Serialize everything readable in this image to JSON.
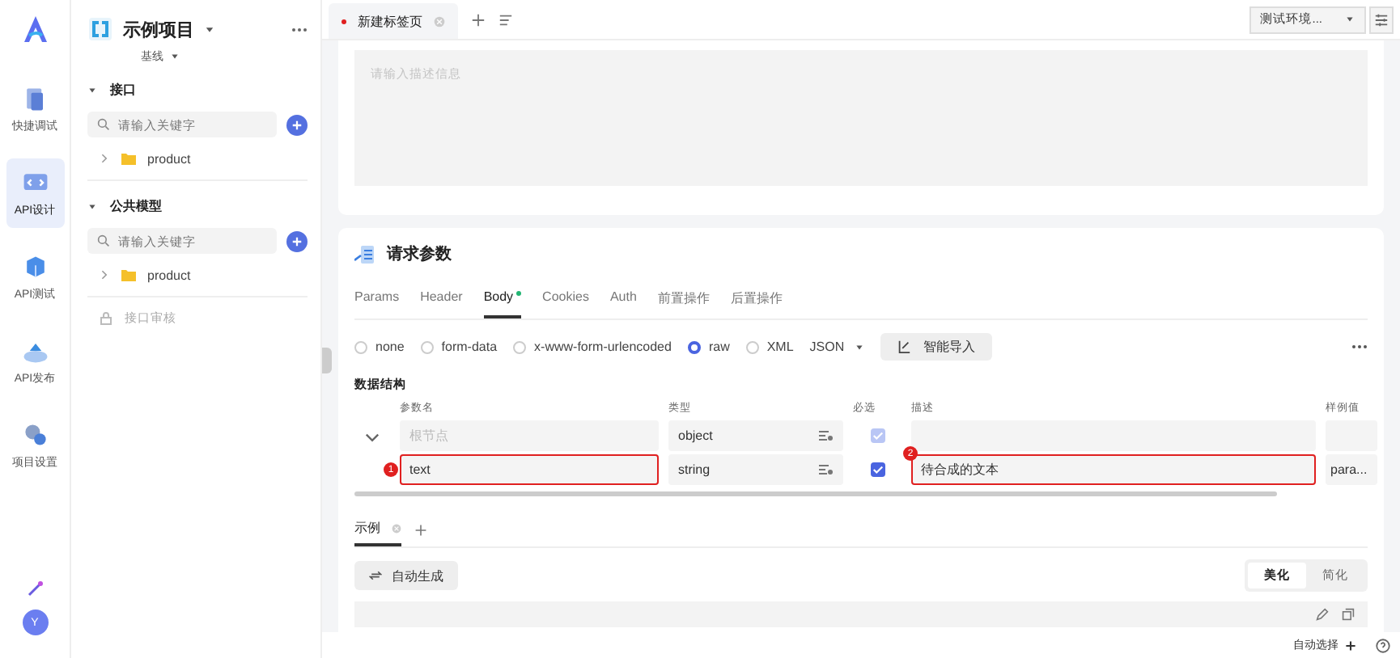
{
  "rail": {
    "items": [
      {
        "label": "快捷调试",
        "selected": false
      },
      {
        "label": "API设计",
        "selected": true
      },
      {
        "label": "API测试",
        "selected": false
      },
      {
        "label": "API发布",
        "selected": false
      },
      {
        "label": "项目设置",
        "selected": false
      }
    ],
    "avatar": "Y"
  },
  "sidebar": {
    "project": "示例项目",
    "branch": "基线",
    "sections": [
      {
        "title": "接口",
        "search_placeholder": "请输入关键字",
        "items": [
          {
            "label": "product"
          }
        ]
      },
      {
        "title": "公共模型",
        "search_placeholder": "请输入关键字",
        "items": [
          {
            "label": "product"
          }
        ]
      }
    ],
    "review": "接口审核"
  },
  "tabs": [
    {
      "label": "新建标签页",
      "selected": true,
      "modified": true
    }
  ],
  "environment": "测试环境...",
  "description": {
    "placeholder": "请输入描述信息"
  },
  "request_params": {
    "title": "请求参数",
    "tabs": [
      {
        "label": "Params",
        "selected": false,
        "has_content": false
      },
      {
        "label": "Header",
        "selected": false,
        "has_content": false
      },
      {
        "label": "Body",
        "selected": true,
        "has_content": true
      },
      {
        "label": "Cookies",
        "selected": false,
        "has_content": false
      },
      {
        "label": "Auth",
        "selected": false,
        "has_content": false
      },
      {
        "label": "前置操作",
        "selected": false,
        "has_content": false
      },
      {
        "label": "后置操作",
        "selected": false,
        "has_content": false
      }
    ],
    "body_types": [
      {
        "label": "none",
        "selected": false
      },
      {
        "label": "form-data",
        "selected": false
      },
      {
        "label": "x-www-form-urlencoded",
        "selected": false
      },
      {
        "label": "raw",
        "selected": true
      },
      {
        "label": "XML",
        "selected": false
      }
    ],
    "format": "JSON",
    "import_button": "智能导入",
    "structure_title": "数据结构",
    "columns": [
      "参数名",
      "类型",
      "必选",
      "描述",
      "样例值"
    ],
    "rows": [
      {
        "expanded": true,
        "name": {
          "placeholder": "根节点"
        },
        "type": "object",
        "required": true,
        "required_disabled": true,
        "description": "",
        "example": ""
      },
      {
        "name": {
          "value": "text",
          "badge": "1"
        },
        "type": "string",
        "required": true,
        "required_disabled": false,
        "description": "待合成的文本",
        "description_badge": "2",
        "example": "para..."
      }
    ]
  },
  "examples": {
    "tabs": [
      {
        "label": "示例",
        "selected": true
      }
    ],
    "generate_button": "自动生成",
    "modes": [
      {
        "label": "美化",
        "selected": true
      },
      {
        "label": "简化",
        "selected": false
      }
    ]
  },
  "status_bar": {
    "label": "自动选择"
  }
}
